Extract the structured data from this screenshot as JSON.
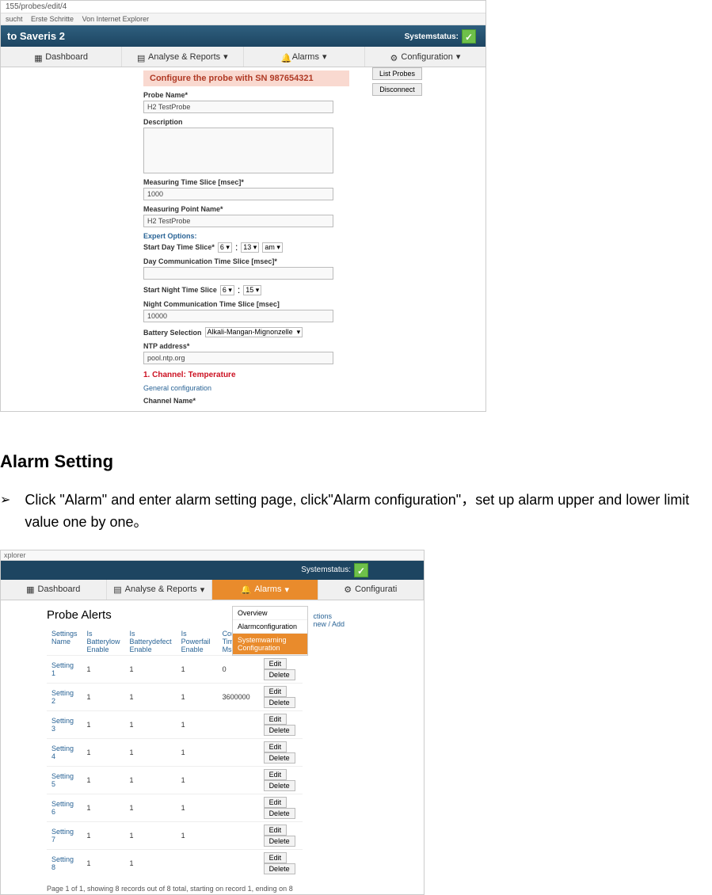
{
  "shot1": {
    "address": "155/probes/edit/4",
    "bookmarks": [
      "sucht",
      "Erste Schritte",
      "Von Internet Explorer"
    ],
    "brand": "to Saveris 2",
    "systemstatus_label": "Systemstatus:",
    "nav": {
      "dashboard": "Dashboard",
      "analyse": "Analyse & Reports",
      "alarms": "Alarms",
      "config": "Configuration"
    },
    "side": {
      "list": "List Probes",
      "disconnect": "Disconnect"
    },
    "form": {
      "header": "Configure the probe with SN 987654321",
      "probe_name_lbl": "Probe Name*",
      "probe_name_val": "H2 TestProbe",
      "description_lbl": "Description",
      "mts_lbl": "Measuring Time Slice [msec]*",
      "mts_val": "1000",
      "mpn_lbl": "Measuring Point Name*",
      "mpn_val": "H2 TestProbe",
      "expert": "Expert Options:",
      "sdts_lbl": "Start Day Time Slice*",
      "sdts_h": "6",
      "sdts_m": "13",
      "sdts_ampm": "am",
      "dcts_lbl": "Day Communication Time Slice [msec]*",
      "snts_lbl": "Start Night Time Slice",
      "snts_h": "6",
      "snts_m": "15",
      "ncts_lbl": "Night Communication Time Slice [msec]",
      "ncts_val": "10000",
      "battery_lbl": "Battery Selection",
      "battery_val": "Alkali-Mangan-Mignonzelle",
      "ntp_lbl": "NTP address*",
      "ntp_val": "pool.ntp.org",
      "channel": "1. Channel: Temperature",
      "general": "General configuration",
      "chname_lbl": "Channel Name*"
    }
  },
  "doc": {
    "heading": "Alarm Setting",
    "bullet": "Click \"Alarm\" and enter alarm setting page, click\"Alarm configuration\"，set up alarm upper and lower limit value one by one。"
  },
  "shot2": {
    "explorer": "xplorer",
    "systemstatus_label": "Systemstatus:",
    "nav": {
      "dashboard": "Dashboard",
      "analyse": "Analyse & Reports",
      "alarms": "Alarms",
      "config": "Configurati"
    },
    "dropdown": {
      "overview": "Overview",
      "alarmconf": "Alarmconfiguration",
      "syswarn": "Systemwarning Configuration"
    },
    "page_title": "Probe Alerts",
    "actions_label": "ctions",
    "new_add": "new / Add",
    "headers": {
      "name": "Settings Name",
      "blow": "Is Batterylow Enable",
      "bdef": "Is Batterydefect Enable",
      "pfail": "Is Powerfail Enable",
      "comm": "Comm Timeout Msec",
      "act": "Actions"
    },
    "rows": [
      {
        "name": "Setting 1",
        "blow": "1",
        "bdef": "1",
        "pfail": "1",
        "comm": "0"
      },
      {
        "name": "Setting 2",
        "blow": "1",
        "bdef": "1",
        "pfail": "1",
        "comm": "3600000"
      },
      {
        "name": "Setting 3",
        "blow": "1",
        "bdef": "1",
        "pfail": "1",
        "comm": ""
      },
      {
        "name": "Setting 4",
        "blow": "1",
        "bdef": "1",
        "pfail": "1",
        "comm": ""
      },
      {
        "name": "Setting 5",
        "blow": "1",
        "bdef": "1",
        "pfail": "1",
        "comm": ""
      },
      {
        "name": "Setting 6",
        "blow": "1",
        "bdef": "1",
        "pfail": "1",
        "comm": ""
      },
      {
        "name": "Setting 7",
        "blow": "1",
        "bdef": "1",
        "pfail": "1",
        "comm": ""
      },
      {
        "name": "Setting 8",
        "blow": "1",
        "bdef": "1",
        "pfail": "",
        "comm": ""
      }
    ],
    "btn_edit": "Edit",
    "btn_delete": "Delete",
    "footer": "Page 1 of 1, showing 8 records out of 8 total, starting on record 1, ending on 8"
  }
}
